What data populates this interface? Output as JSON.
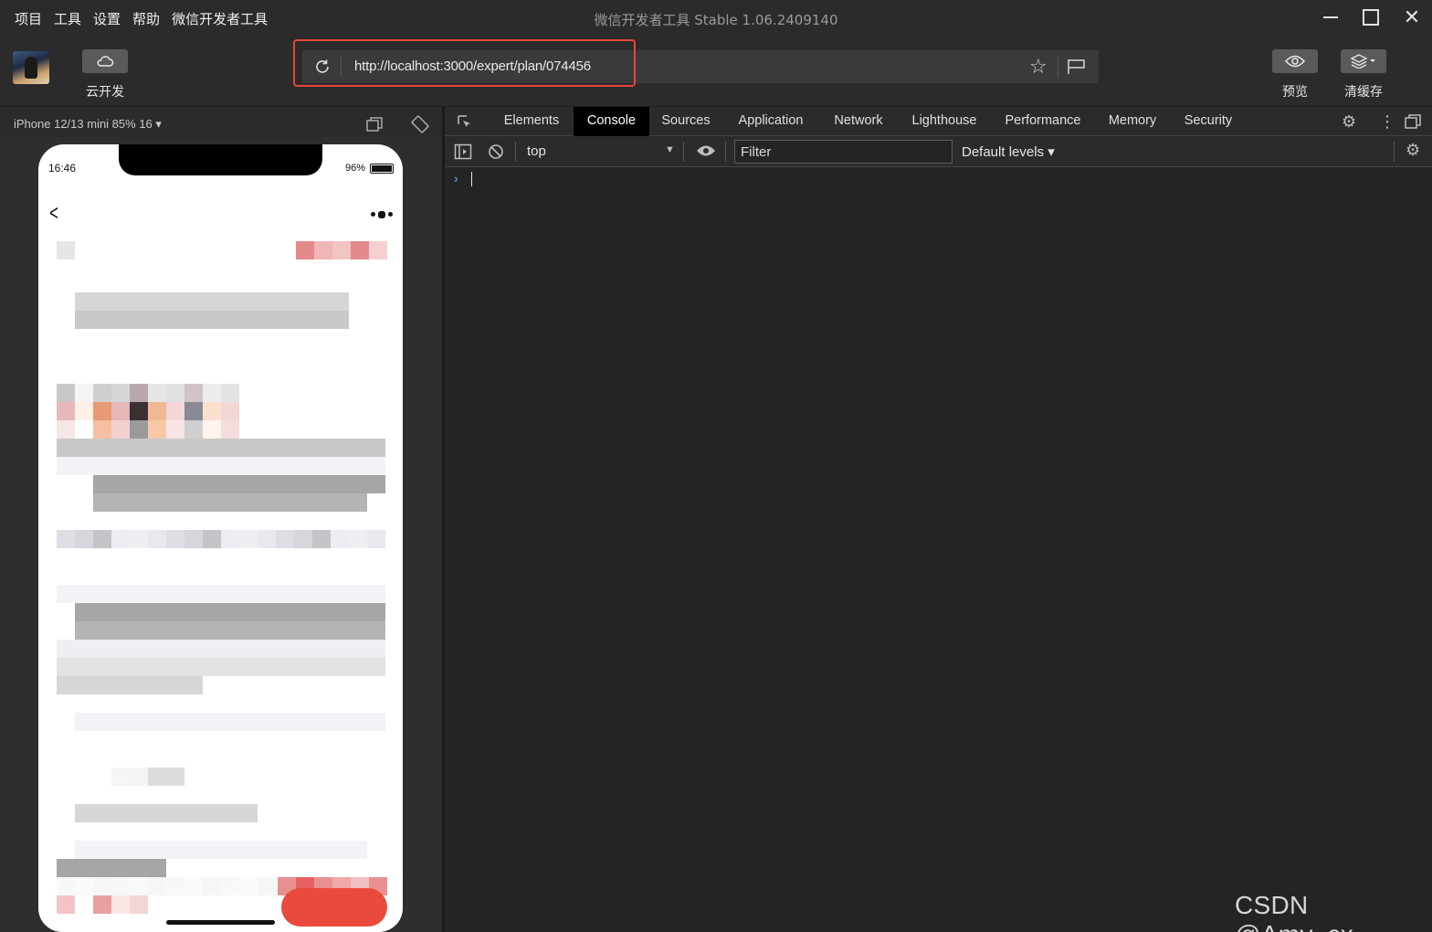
{
  "menu": [
    "项目",
    "工具",
    "设置",
    "帮助",
    "微信开发者工具"
  ],
  "window": {
    "title": "微信开发者工具 Stable 1.06.2409140"
  },
  "toolbar": {
    "cloud_label": "云开发",
    "preview_label": "预览",
    "clear_cache_label": "清缓存",
    "url": "http://localhost:3000/expert/plan/074456"
  },
  "simulator": {
    "device": "iPhone 12/13 mini 85% 16 ▾",
    "time": "16:46",
    "battery": "96%"
  },
  "devtools": {
    "tabs": [
      "Elements",
      "Console",
      "Sources",
      "Application",
      "Network",
      "Lighthouse",
      "Performance",
      "Memory",
      "Security"
    ],
    "active_tab": "Console",
    "context": "top",
    "filter_placeholder": "Filter",
    "levels": "Default levels ▾",
    "prompt": "›"
  },
  "watermark": "CSDN @Amy_cx",
  "colors": {
    "accent_red": "#e84a3c",
    "highlight_border": "#e5463b",
    "active_tab_bg": "#000000"
  }
}
